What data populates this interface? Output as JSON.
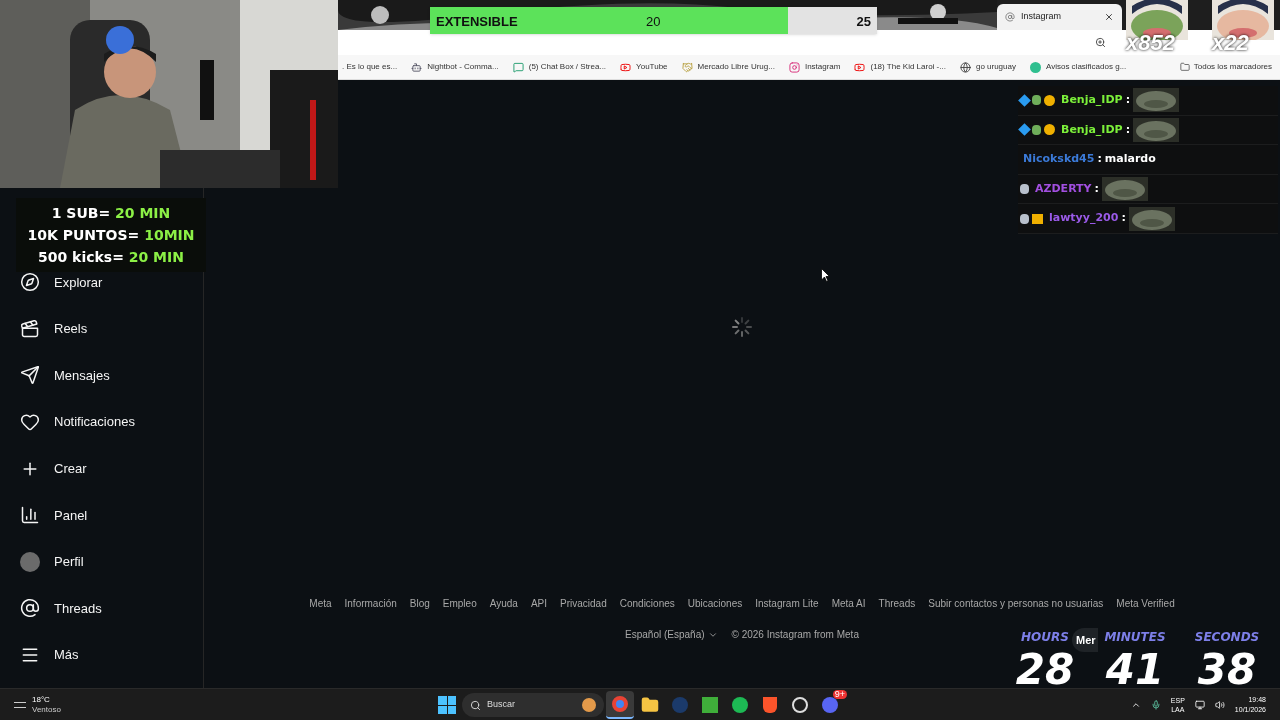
{
  "overlay": {
    "goal": {
      "label": "EXTENSIBLE",
      "current": "20",
      "target": "25",
      "level": 0.8
    },
    "rules": [
      {
        "text": "1 SUB=",
        "highlight": "20 MIN"
      },
      {
        "text": "10K PUNTOS=",
        "highlight": "10MIN"
      },
      {
        "text": "500 kicks=",
        "highlight": "20 MIN"
      }
    ],
    "emote_counters": [
      "x852",
      "x22"
    ],
    "chat": [
      {
        "user": "Benja_IDP",
        "separator": ":",
        "color": "#7cf03a",
        "kind": "emote"
      },
      {
        "user": "Benja_IDP",
        "separator": ":",
        "color": "#7cf03a",
        "kind": "emote"
      },
      {
        "user": "Nicokskd45",
        "separator": ":",
        "color": "#3b7ad8",
        "kind": "text",
        "text": "malardo"
      },
      {
        "user": "AZDERTY",
        "separator": ":",
        "color": "#a24fe0",
        "kind": "emote"
      },
      {
        "user": "lawtyy_200",
        "separator": ":",
        "color": "#9a5ae8",
        "kind": "emote"
      }
    ],
    "timer": [
      {
        "label": "HOURS",
        "value": "28"
      },
      {
        "label": "MINUTES",
        "value": "41"
      },
      {
        "label": "SECONDS",
        "value": "38"
      }
    ]
  },
  "browser": {
    "tab": {
      "title": "Instagram"
    },
    "bookmarks": [
      ". Es lo que es...",
      "Nightbot - Comma...",
      "(5) Chat Box / Strea...",
      "YouTube",
      "Mercado Libre Urug...",
      "Instagram",
      "(18) The Kid Laroi -...",
      "go uruguay",
      "Avisos clasificados g..."
    ],
    "all_bookmarks": "Todos los marcadores"
  },
  "sidebar": {
    "items": [
      "Explorar",
      "Reels",
      "Mensajes",
      "Notificaciones",
      "Crear",
      "Panel",
      "Perfil",
      "Threads",
      "Más"
    ]
  },
  "footer": {
    "links": [
      "Meta",
      "Información",
      "Blog",
      "Empleo",
      "Ayuda",
      "API",
      "Privacidad",
      "Condiciones",
      "Ubicaciones",
      "Instagram Lite",
      "Meta AI",
      "Threads",
      "Subir contactos y personas no usuarias",
      "Meta Verified"
    ],
    "language": "Español (España)",
    "copyright": "© 2026 Instagram from Meta"
  },
  "messages_pill": {
    "label": "Mer"
  },
  "taskbar": {
    "weather": {
      "temp": "18°C",
      "condition": "Ventoso"
    },
    "search": {
      "placeholder": "Buscar"
    },
    "apps": [
      {
        "kind": "chrome",
        "selected": true
      },
      {
        "kind": "folder",
        "selected": false
      },
      {
        "kind": "steam",
        "selected": false
      },
      {
        "kind": "minecraft",
        "selected": false
      },
      {
        "kind": "spotify",
        "selected": false
      },
      {
        "kind": "brave",
        "selected": false
      },
      {
        "kind": "obs",
        "selected": false
      },
      {
        "kind": "discord",
        "selected": false,
        "badge": "9+"
      }
    ],
    "language": [
      "ESP",
      "LAA"
    ],
    "time": "19:48",
    "date": "10/1/2026"
  }
}
